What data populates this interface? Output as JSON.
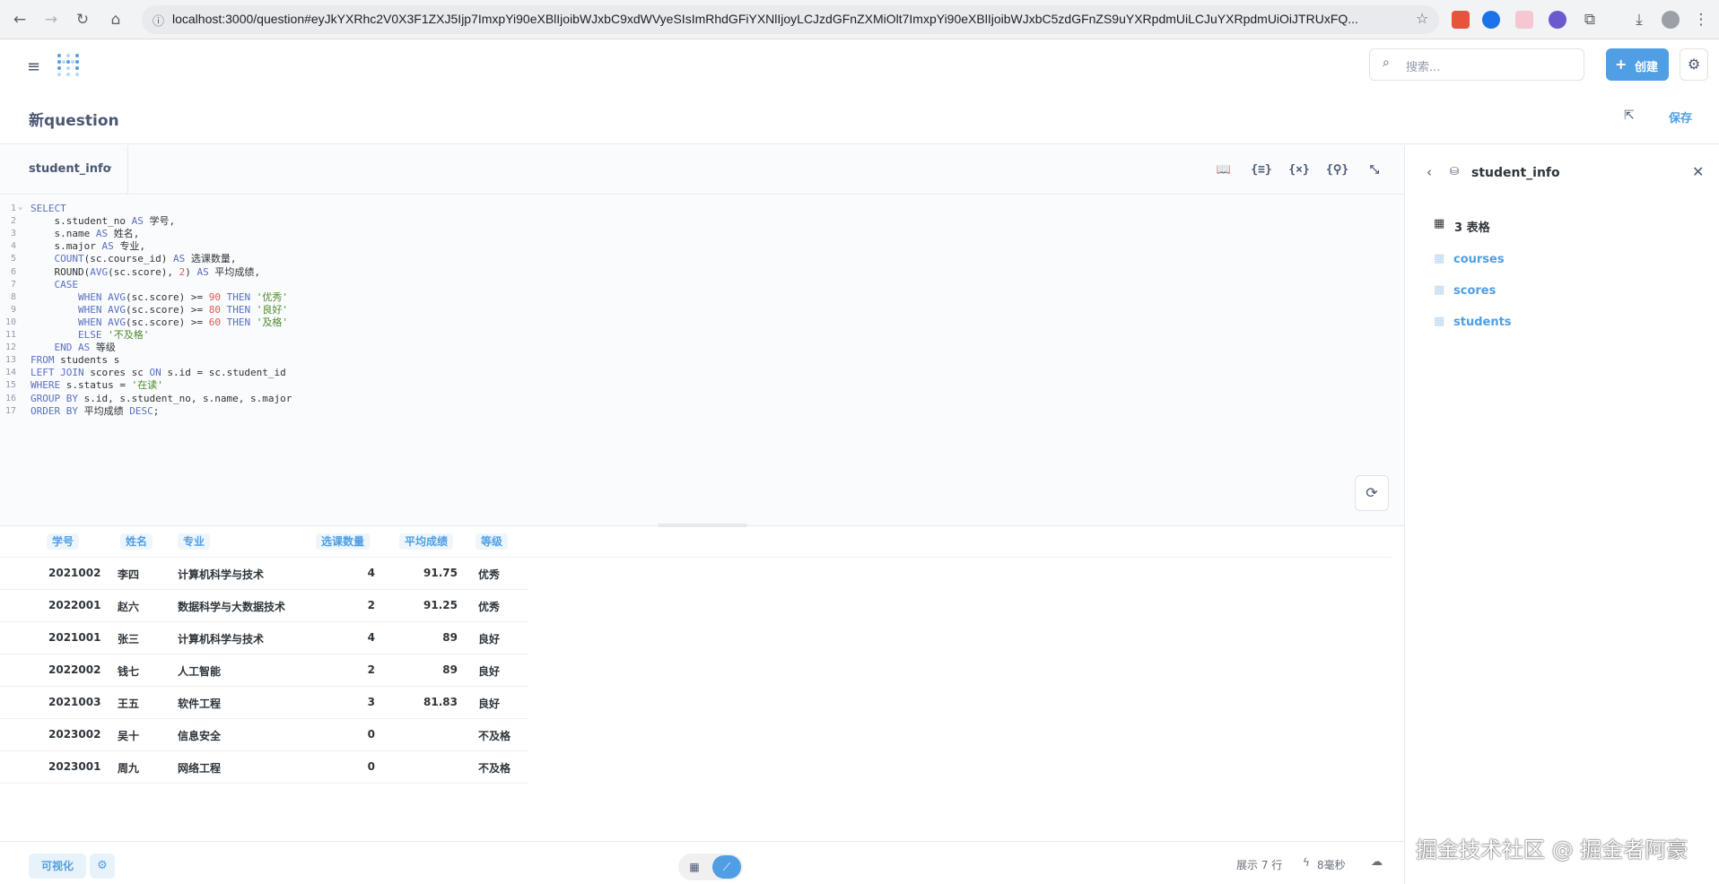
{
  "browser": {
    "url": "localhost:3000/question#eyJkYXRhc2V0X3F1ZXJ5Ijp7ImxpYi90eXBlIjoibWJxbC9xdWVyeSIsImRhdGFiYXNlIjoyLCJzdGFnZXMiOlt7ImxpYi90eXBlIjoibWJxbC5zdGFnZS9uYXRpdmUiLCJuYXRpdmUiOiJTRUxFQ..."
  },
  "header": {
    "search_placeholder": "搜索...",
    "new_button": "创建"
  },
  "title": {
    "question_title": "新question",
    "save": "保存"
  },
  "editor": {
    "database": "student_info",
    "lines": [
      {
        "n": "1",
        "fold": "⌄",
        "t": [
          [
            "kw",
            "SELECT"
          ]
        ]
      },
      {
        "n": "2",
        "t": [
          [
            "p",
            "    s.student_no "
          ],
          [
            "kw",
            "AS"
          ],
          [
            "p",
            " 学号,"
          ]
        ]
      },
      {
        "n": "3",
        "t": [
          [
            "p",
            "    s.name "
          ],
          [
            "kw",
            "AS"
          ],
          [
            "p",
            " 姓名,"
          ]
        ]
      },
      {
        "n": "4",
        "t": [
          [
            "p",
            "    s.major "
          ],
          [
            "kw",
            "AS"
          ],
          [
            "p",
            " 专业,"
          ]
        ]
      },
      {
        "n": "5",
        "t": [
          [
            "p",
            "    "
          ],
          [
            "kw",
            "COUNT"
          ],
          [
            "p",
            "(sc.course_id) "
          ],
          [
            "kw",
            "AS"
          ],
          [
            "p",
            " 选课数量,"
          ]
        ]
      },
      {
        "n": "6",
        "t": [
          [
            "p",
            "    ROUND("
          ],
          [
            "kw",
            "AVG"
          ],
          [
            "p",
            "(sc.score), "
          ],
          [
            "num",
            "2"
          ],
          [
            "p",
            ") "
          ],
          [
            "kw",
            "AS"
          ],
          [
            "p",
            " 平均成绩,"
          ]
        ]
      },
      {
        "n": "7",
        "t": [
          [
            "kw",
            "    CASE"
          ]
        ]
      },
      {
        "n": "8",
        "t": [
          [
            "kw",
            "        WHEN"
          ],
          [
            "p",
            " "
          ],
          [
            "kw",
            "AVG"
          ],
          [
            "p",
            "(sc.score) >= "
          ],
          [
            "num",
            "90"
          ],
          [
            "p",
            " "
          ],
          [
            "kw",
            "THEN"
          ],
          [
            "p",
            " "
          ],
          [
            "str",
            "'优秀'"
          ]
        ]
      },
      {
        "n": "9",
        "t": [
          [
            "kw",
            "        WHEN"
          ],
          [
            "p",
            " "
          ],
          [
            "kw",
            "AVG"
          ],
          [
            "p",
            "(sc.score) >= "
          ],
          [
            "num",
            "80"
          ],
          [
            "p",
            " "
          ],
          [
            "kw",
            "THEN"
          ],
          [
            "p",
            " "
          ],
          [
            "str",
            "'良好'"
          ]
        ]
      },
      {
        "n": "10",
        "t": [
          [
            "kw",
            "        WHEN"
          ],
          [
            "p",
            " "
          ],
          [
            "kw",
            "AVG"
          ],
          [
            "p",
            "(sc.score) >= "
          ],
          [
            "num",
            "60"
          ],
          [
            "p",
            " "
          ],
          [
            "kw",
            "THEN"
          ],
          [
            "p",
            " "
          ],
          [
            "str",
            "'及格'"
          ]
        ]
      },
      {
        "n": "11",
        "t": [
          [
            "kw",
            "        ELSE"
          ],
          [
            "p",
            " "
          ],
          [
            "str",
            "'不及格'"
          ]
        ]
      },
      {
        "n": "12",
        "t": [
          [
            "kw",
            "    END"
          ],
          [
            "p",
            " "
          ],
          [
            "kw",
            "AS"
          ],
          [
            "p",
            " 等级"
          ]
        ]
      },
      {
        "n": "13",
        "t": [
          [
            "kw",
            "FROM"
          ],
          [
            "p",
            " students s"
          ]
        ]
      },
      {
        "n": "14",
        "t": [
          [
            "kw",
            "LEFT JOIN"
          ],
          [
            "p",
            " scores sc "
          ],
          [
            "kw",
            "ON"
          ],
          [
            "p",
            " s.id = sc.student_id"
          ]
        ]
      },
      {
        "n": "15",
        "t": [
          [
            "kw",
            "WHERE"
          ],
          [
            "p",
            " s.status = "
          ],
          [
            "str",
            "'在读'"
          ]
        ]
      },
      {
        "n": "16",
        "t": [
          [
            "kw",
            "GROUP BY"
          ],
          [
            "p",
            " s.id, s.student_no, s.name, s.major"
          ]
        ]
      },
      {
        "n": "17",
        "t": [
          [
            "kw",
            "ORDER BY"
          ],
          [
            "p",
            " 平均成绩 "
          ],
          [
            "kw",
            "DESC"
          ],
          [
            "p",
            ";"
          ]
        ]
      }
    ]
  },
  "table": {
    "columns": [
      "学号",
      "姓名",
      "专业",
      "选课数量",
      "平均成绩",
      "等级"
    ],
    "rows": [
      [
        "2021002",
        "李四",
        "计算机科学与技术",
        "4",
        "91.75",
        "优秀"
      ],
      [
        "2022001",
        "赵六",
        "数据科学与大数据技术",
        "2",
        "91.25",
        "优秀"
      ],
      [
        "2021001",
        "张三",
        "计算机科学与技术",
        "4",
        "89",
        "良好"
      ],
      [
        "2022002",
        "钱七",
        "人工智能",
        "2",
        "89",
        "良好"
      ],
      [
        "2021003",
        "王五",
        "软件工程",
        "3",
        "81.83",
        "良好"
      ],
      [
        "2023002",
        "吴十",
        "信息安全",
        "0",
        "",
        "不及格"
      ],
      [
        "2023001",
        "周九",
        "网络工程",
        "0",
        "",
        "不及格"
      ]
    ]
  },
  "footer": {
    "visualize": "可视化",
    "row_count": "展示 7 行",
    "timing": "8毫秒"
  },
  "sidebar": {
    "database": "student_info",
    "tables_count": "3 表格",
    "tables": [
      "courses",
      "scores",
      "students"
    ]
  },
  "watermark": "掘金技术社区 @ 掘金者阿豪"
}
